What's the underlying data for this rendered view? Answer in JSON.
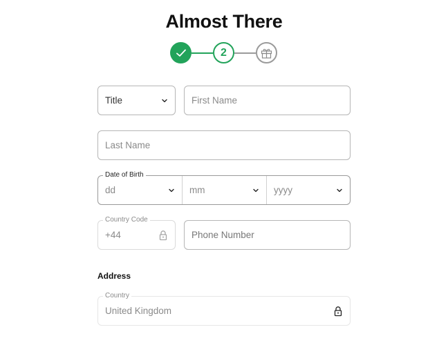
{
  "header": {
    "title": "Almost There"
  },
  "stepper": {
    "steps": [
      {
        "state": "completed",
        "icon": "check-icon"
      },
      {
        "state": "active",
        "label": "2"
      },
      {
        "state": "pending",
        "icon": "gift-icon"
      }
    ],
    "colors": {
      "active": "#22a35a",
      "inactive": "#9a9a9a"
    }
  },
  "form": {
    "title_select": {
      "value": "Title",
      "icon": "chevron-down-icon"
    },
    "first_name": {
      "placeholder": "First Name"
    },
    "last_name": {
      "placeholder": "Last Name"
    },
    "dob": {
      "legend": "Date of Birth",
      "day": {
        "placeholder": "dd"
      },
      "month": {
        "placeholder": "mm"
      },
      "year": {
        "placeholder": "yyyy"
      }
    },
    "country_code": {
      "legend": "Country Code",
      "value": "+44",
      "icon": "lock-icon"
    },
    "phone": {
      "placeholder": "Phone Number"
    },
    "address": {
      "section_label": "Address",
      "country": {
        "legend": "Country",
        "value": "United Kingdom",
        "icon": "lock-icon"
      }
    }
  }
}
